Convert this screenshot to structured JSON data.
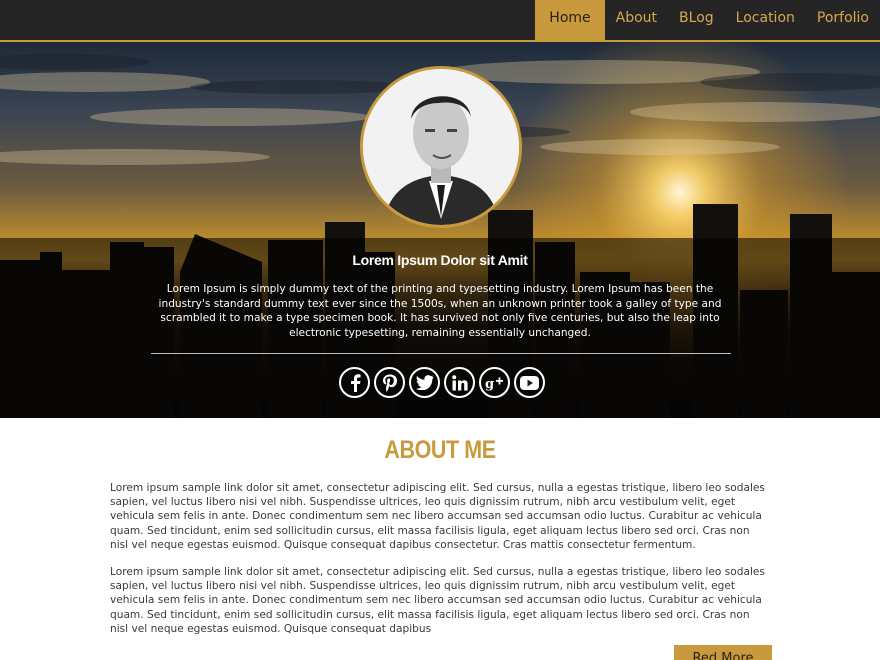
{
  "nav": {
    "items": [
      {
        "label": "Home",
        "active": true
      },
      {
        "label": "About"
      },
      {
        "label": "BLog"
      },
      {
        "label": "Location"
      },
      {
        "label": "Porfolio"
      }
    ]
  },
  "hero": {
    "title": "Lorem Ipsum Dolor sit Amit",
    "description": "Lorem Ipsum is simply dummy text of the printing and typesetting industry. Lorem Ipsum has been the industry's standard dummy text ever since the 1500s, when an unknown printer took a galley of type and scrambled it to make a type specimen book. It has survived not only five centuries, but also the leap into electronic typesetting, remaining essentially unchanged.",
    "socials": [
      "facebook-icon",
      "pinterest-icon",
      "twitter-icon",
      "linkedin-icon",
      "google-plus-icon",
      "youtube-icon"
    ]
  },
  "about": {
    "heading": "ABOUT ME",
    "paragraph1": "Lorem ipsum sample link dolor sit amet, consectetur adipiscing elit. Sed cursus, nulla a egestas tristique, libero leo sodales sapien, vel luctus libero nisi vel nibh. Suspendisse ultrices, leo quis dignissim rutrum, nibh arcu vestibulum velit, eget vehicula sem felis in ante. Donec condimentum sem nec libero accumsan sed accumsan odio luctus. Curabitur ac vehicula quam. Sed tincidunt, enim sed sollicitudin cursus, elit massa facilisis ligula, eget aliquam lectus libero sed orci. Cras non nisl vel neque egestas euismod. Quisque consequat dapibus consectetur. Cras mattis consectetur fermentum.",
    "paragraph2": "Lorem ipsum sample link dolor sit amet, consectetur adipiscing elit. Sed cursus, nulla a egestas tristique, libero leo sodales sapien, vel luctus libero nisi vel nibh. Suspendisse ultrices, leo quis dignissim rutrum, nibh arcu vestibulum velit, eget vehicula sem felis in ante. Donec condimentum sem nec libero accumsan sed accumsan odio luctus. Curabitur ac vehicula quam. Sed tincidunt, enim sed sollicitudin cursus, elit massa facilisis ligula, eget aliquam lectus libero sed orci. Cras non nisl vel neque egestas euismod. Quisque consequat dapibus",
    "button_label": "Red More"
  },
  "colors": {
    "accent": "#c99a3d",
    "nav_bg": "#252525"
  }
}
